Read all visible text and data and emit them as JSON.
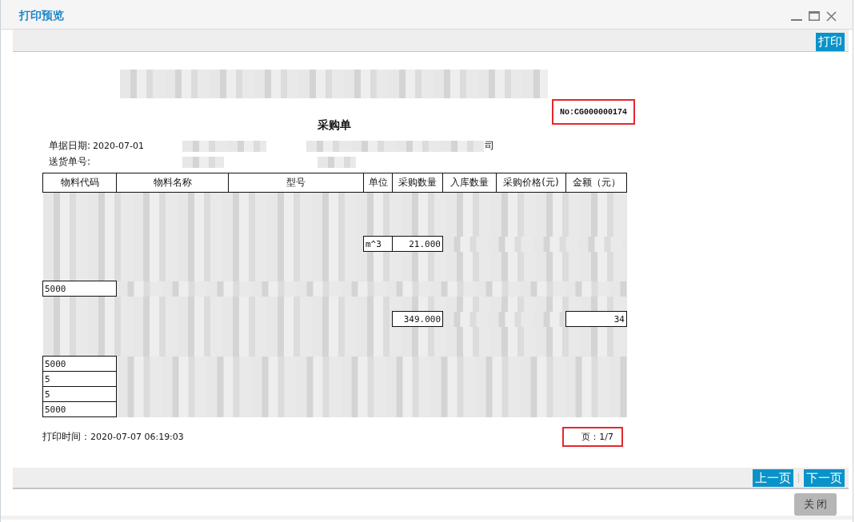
{
  "window": {
    "title": "打印预览"
  },
  "toolbar": {
    "buttons": [
      "打印"
    ]
  },
  "document": {
    "number": "No:CG000000174",
    "title": "采购单",
    "header_fields": [
      {
        "label": "单据日期:",
        "value": "2020-07-01",
        "company": "司"
      },
      {
        "label": "送货单号:"
      }
    ],
    "table": {
      "columns": [
        "物料代码",
        "物料名称",
        "型号",
        "单位",
        "采购数量",
        "入库数量",
        "采购价格(元)",
        "金额（元）"
      ],
      "rows": [
        {
          "cells": [
            null,
            null,
            null,
            null,
            null,
            null,
            null,
            null
          ]
        },
        {
          "cells": [
            null,
            null,
            null,
            null,
            null,
            null,
            null,
            null
          ]
        },
        {
          "cells": [
            null,
            null,
            null,
            null,
            null,
            null,
            null,
            null
          ]
        },
        {
          "cells": [
            null,
            null,
            null,
            "m^3",
            "21.000",
            null,
            null,
            null
          ]
        },
        {
          "cells": [
            null,
            null,
            null,
            null,
            null,
            null,
            null,
            null
          ]
        },
        {
          "cells": [
            null,
            null,
            null,
            null,
            null,
            null,
            null,
            null
          ]
        },
        {
          "cells": [
            "5000",
            null,
            null,
            null,
            null,
            null,
            null,
            null
          ]
        },
        {
          "cells": [
            null,
            null,
            null,
            null,
            null,
            null,
            null,
            null
          ]
        },
        {
          "cells": [
            null,
            null,
            null,
            null,
            "349.000",
            null,
            null,
            "34"
          ]
        },
        {
          "cells": [
            null,
            null,
            null,
            null,
            null,
            null,
            null,
            null
          ]
        },
        {
          "cells": [
            null,
            null,
            null,
            null,
            null,
            null,
            null,
            null
          ]
        },
        {
          "cells": [
            "5000",
            null,
            null,
            null,
            null,
            null,
            null,
            null
          ]
        },
        {
          "cells": [
            "5",
            null,
            null,
            null,
            null,
            null,
            null,
            null
          ]
        },
        {
          "cells": [
            "5",
            null,
            null,
            null,
            null,
            null,
            null,
            null
          ]
        },
        {
          "cells": [
            "5000",
            null,
            null,
            null,
            null,
            null,
            null,
            null
          ]
        }
      ]
    },
    "print_time": {
      "label": "打印时间：",
      "value": "2020-07-07 06:19:03"
    },
    "page": "页：1/7"
  },
  "pager": {
    "buttons": [
      "上一页",
      "下一页"
    ]
  },
  "footer": {
    "buttons": [
      "关闭"
    ]
  }
}
